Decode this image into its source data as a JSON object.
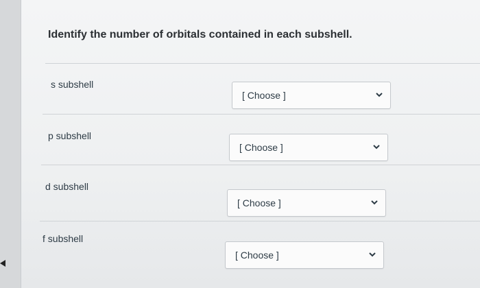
{
  "question": "Identify the number of orbitals contained in each subshell.",
  "rows": [
    {
      "label": "s subshell",
      "selected": "[ Choose ]"
    },
    {
      "label": "p subshell",
      "selected": "[ Choose ]"
    },
    {
      "label": "d subshell",
      "selected": "[ Choose ]"
    },
    {
      "label": "f subshell",
      "selected": "[ Choose ]"
    }
  ],
  "icons": {
    "dropdown": "chevron-down-icon"
  },
  "colors": {
    "text": "#2d3b45",
    "background": "#f2f3f4"
  }
}
